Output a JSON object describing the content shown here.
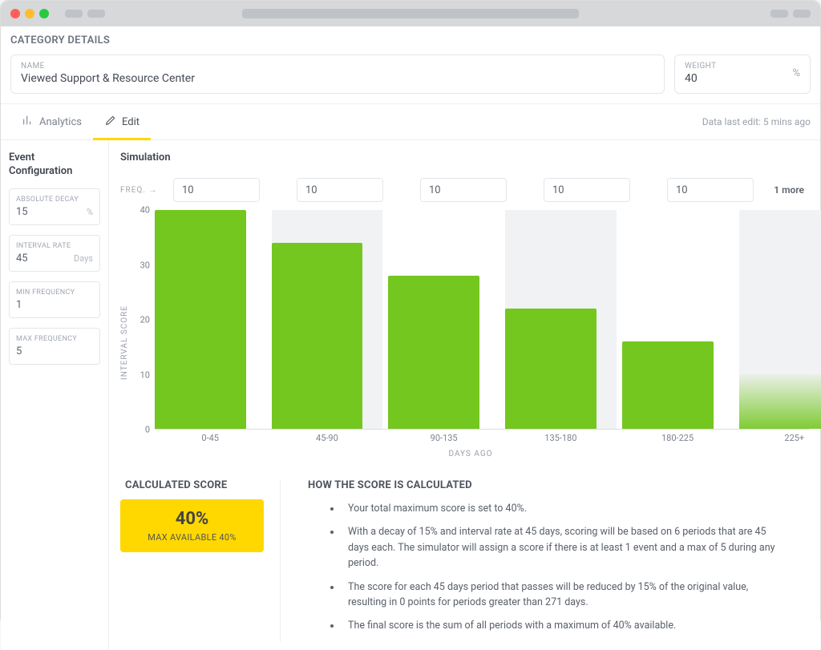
{
  "header": {
    "title": "CATEGORY DETAILS"
  },
  "fields": {
    "name_label": "NAME",
    "name_value": "Viewed Support & Resource Center",
    "weight_label": "WEIGHT",
    "weight_value": "40",
    "weight_unit": "%"
  },
  "tabs": {
    "analytics": "Analytics",
    "edit": "Edit",
    "last_edit": "Data last edit: 5 mins ago"
  },
  "sidebar": {
    "title": "Event Configuration",
    "decay_label": "ABSOLUTE DECAY",
    "decay_value": "15",
    "decay_unit": "%",
    "interval_label": "INTERVAL RATE",
    "interval_value": "45",
    "interval_unit": "Days",
    "minfreq_label": "MIN FREQUENCY",
    "minfreq_value": "1",
    "maxfreq_label": "MAX FREQUENCY",
    "maxfreq_value": "5"
  },
  "simulation": {
    "title": "Simulation",
    "freq_label": "FREQ. →",
    "freq_values": [
      "10",
      "10",
      "10",
      "10",
      "10"
    ],
    "more": "1 more"
  },
  "chart_data": {
    "type": "bar",
    "categories": [
      "0-45",
      "45-90",
      "90-135",
      "135-180",
      "180-225",
      "225+"
    ],
    "values": [
      40,
      34,
      28,
      22,
      16,
      10
    ],
    "title": "",
    "xlabel": "DAYS AGO",
    "ylabel": "INTERVAL SCORE",
    "ylim": [
      0,
      40
    ],
    "y_ticks": [
      0,
      10,
      20,
      30,
      40
    ],
    "last_bar_partial": true
  },
  "score": {
    "head": "CALCULATED SCORE",
    "big": "40%",
    "sub": "MAX AVAILABLE 40%"
  },
  "how": {
    "head": "HOW THE SCORE IS CALCULATED",
    "items": [
      "Your total maximum score is set to 40%.",
      "With a decay of 15% and interval rate at 45 days, scoring will be based on 6 periods that are 45 days each. The simulator will assign a score if there is at least 1 event and a max of 5 during any period.",
      "The score for each 45 days period that passes will be reduced by 15% of the original value, resulting in 0 points for periods greater than 271 days.",
      "The final score is the sum of all periods with a maximum of 40% available."
    ]
  }
}
